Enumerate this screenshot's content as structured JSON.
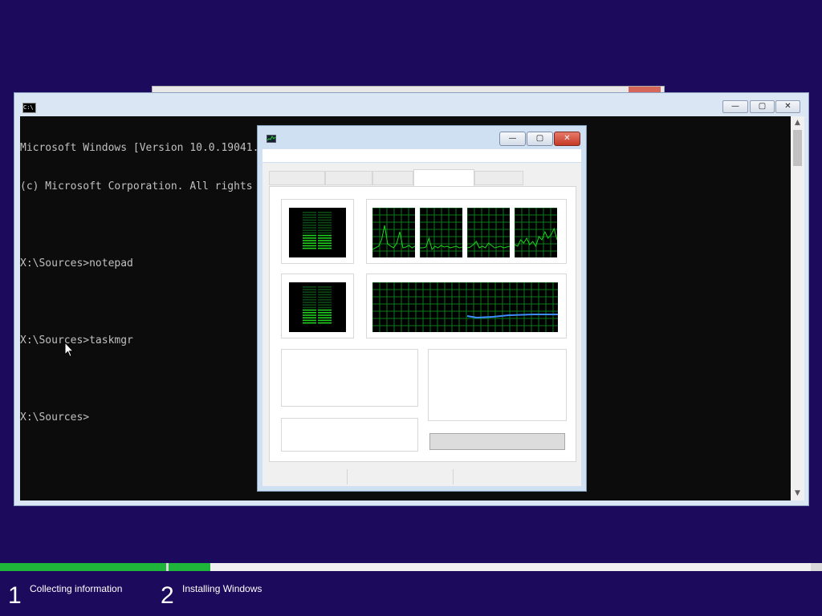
{
  "background_window": {
    "accent": "#d6655a"
  },
  "cmd_window": {
    "icon_text": "C:\\",
    "buttons": {
      "minimize": "—",
      "maximize": "▢",
      "close": "✕"
    },
    "console_lines": [
      "Microsoft Windows [Version 10.0.19041.2006]",
      "(c) Microsoft Corporation. All rights reserved.",
      "",
      "X:\\Sources>notepad",
      "",
      "X:\\Sources>taskmgr",
      "",
      "X:\\Sources>"
    ],
    "scroll": {
      "up": "▲",
      "down": "▼"
    }
  },
  "task_manager": {
    "buttons": {
      "minimize": "—",
      "maximize": "▢",
      "close": "✕"
    },
    "active_tab_index": 3,
    "cpu_graph_count": 4,
    "colors": {
      "meter_green": "#1ed21e",
      "grid_green": "#0a7a1e",
      "memory_line": "#3c8cff"
    }
  },
  "setup_progress": {
    "step1_progress": 1.0,
    "step2_progress": 0.065,
    "colors": {
      "fill": "#1eb53a",
      "track": "#f0f0f0"
    },
    "steps": [
      {
        "number": "1",
        "label": "Collecting information"
      },
      {
        "number": "2",
        "label": "Installing Windows"
      }
    ]
  }
}
